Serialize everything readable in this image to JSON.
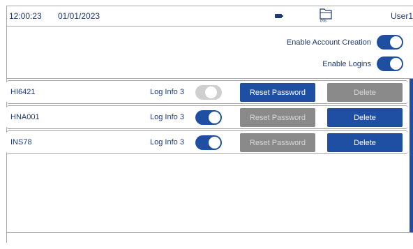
{
  "status": {
    "time": "12:00:23",
    "date": "01/01/2023",
    "storage_percent": "0%",
    "user": "User1"
  },
  "settings": {
    "account_creation_label": "Enable Account Creation",
    "account_creation_enabled": true,
    "logins_label": "Enable Logins",
    "logins_enabled": true
  },
  "accounts": [
    {
      "name": "HI6421",
      "log_label": "Log Info 3",
      "log_enabled": false,
      "reset_label": "Reset Password",
      "reset_enabled": true,
      "delete_label": "Delete",
      "delete_enabled": false
    },
    {
      "name": "HNA001",
      "log_label": "Log Info 3",
      "log_enabled": true,
      "reset_label": "Reset Password",
      "reset_enabled": false,
      "delete_label": "Delete",
      "delete_enabled": true
    },
    {
      "name": "INS78",
      "log_label": "Log Info 3",
      "log_enabled": true,
      "reset_label": "Reset Password",
      "reset_enabled": false,
      "delete_label": "Delete",
      "delete_enabled": true
    }
  ],
  "colors": {
    "accent": "#1f4fa3",
    "text": "#1f3a73",
    "disabled": "#8a8a8a",
    "toggle_off": "#cfcfcf"
  }
}
